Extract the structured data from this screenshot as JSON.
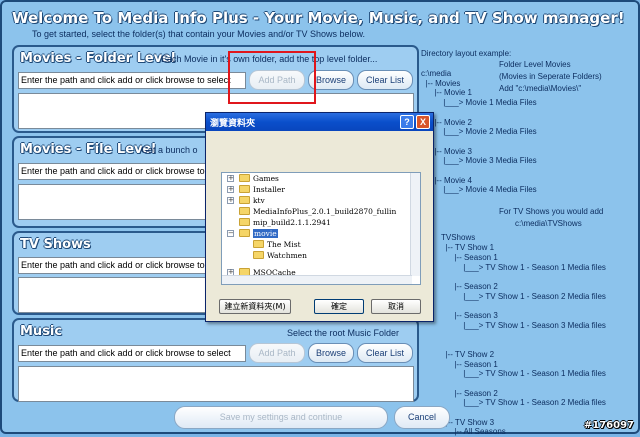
{
  "app": {
    "title": "Welcome To Media Info Plus - Your Movie, Music, and TV Show manager!",
    "subtitle": "To get started, select the folder(s) that contain your Movies and/or TV Shows below."
  },
  "sections": {
    "movies_folder": {
      "title": "Movies - Folder Level",
      "description": "Each Movie in it's own folder, add the top level folder...",
      "input_value": "Enter the path and click add or click browse to select",
      "add_label": "Add Path",
      "browse_label": "Browse",
      "clear_label": "Clear List"
    },
    "movies_file": {
      "title": "Movies - File Level",
      "description": "Got a bunch o",
      "input_value": "Enter the path and click add or click browse to"
    },
    "tv_shows": {
      "title": "TV Shows",
      "input_value": "Enter the path and click add or click browse to"
    },
    "music": {
      "title": "Music",
      "description": "Select the root Music Folder",
      "input_value": "Enter the path and click add or click browse to select",
      "add_label": "Add Path",
      "browse_label": "Browse",
      "clear_label": "Clear List"
    }
  },
  "layout_example": {
    "heading": "Directory layout example:",
    "lines": [
      "c:\\media",
      "  |-- Movies",
      "      |-- Movie 1",
      "          |___> Movie 1 Media Files",
      "      |-- Movie 2",
      "          |___> Movie 2 Media Files",
      "      |-- Movie 3",
      "          |___> Movie 3 Media Files",
      "      |-- Movie 4",
      "          |___> Movie 4 Media Files",
      "TVShows",
      "  |-- TV Show 1",
      "      |-- Season 1",
      "          |___> TV Show 1 - Season 1 Media files",
      "      |-- Season 2",
      "          |___> TV Show 1 - Season 2 Media files",
      "      |-- Season 3",
      "          |___> TV Show 1 - Season 3 Media files",
      "  |-- TV Show 2",
      "      |-- Season 1",
      "          |___> TV Show 1 - Season 1 Media files",
      "      |-- Season 2",
      "          |___> TV Show 1 - Season 2 Media files",
      "  |-- TV Show 3",
      "      |-- All Seasons"
    ],
    "note_folder_movies": [
      "Folder Level Movies",
      "(Movies in Seperate Folders)",
      "Add \"c:\\media\\Movies\\\""
    ],
    "note_tv": [
      "For TV Shows you would add",
      "c:\\media\\TVShows"
    ]
  },
  "footer": {
    "save_label": "Save my settings and continue",
    "cancel_label": "Cancel"
  },
  "dialog": {
    "title": "瀏覽資料夾",
    "help_glyph": "?",
    "close_glyph": "X",
    "tree_items": [
      {
        "label": "Games",
        "expandable": true
      },
      {
        "label": "Installer",
        "expandable": true
      },
      {
        "label": "ktv",
        "expandable": true
      },
      {
        "label": "MediaInfoPlus_2.0.1_build2870_fullin",
        "expandable": false
      },
      {
        "label": "mip_build2.1.1.2941",
        "expandable": false
      },
      {
        "label": "movie",
        "expandable": true,
        "selected": true
      },
      {
        "label": "The Mist",
        "expandable": false
      },
      {
        "label": "Watchmen",
        "expandable": false
      },
      {
        "label": "MSOCache",
        "expandable": true
      }
    ],
    "new_folder_label": "建立新資料夾(M)",
    "ok_label": "確定",
    "cancel_label": "取消"
  },
  "watermark": "#176097",
  "colors": {
    "background": "#8cc3ec",
    "highlight": "#e0161c",
    "selection": "#316ac5"
  }
}
